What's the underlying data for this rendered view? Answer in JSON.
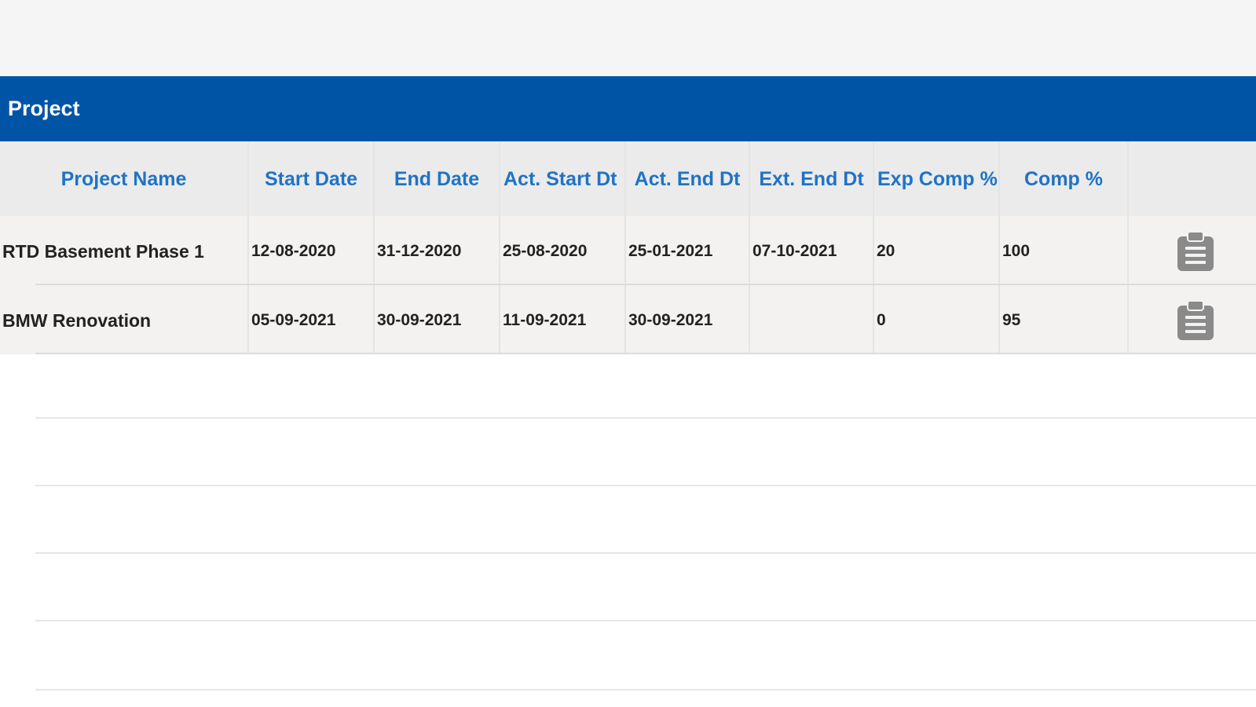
{
  "section": {
    "title": "Project"
  },
  "table": {
    "headers": [
      "Project Name",
      "Start Date",
      "End Date",
      "Act. Start Dt",
      "Act. End Dt",
      "Ext. End Dt",
      "Exp Comp %",
      "Comp %",
      ""
    ],
    "rows": [
      {
        "project_name": "RTD Basement Phase 1",
        "start_date": "12-08-2020",
        "end_date": "31-12-2020",
        "act_start_dt": "25-08-2020",
        "act_end_dt": "25-01-2021",
        "ext_end_dt": "07-10-2021",
        "exp_comp_pct": "20",
        "comp_pct": "100",
        "action_icon": "clipboard-icon"
      },
      {
        "project_name": "BMW Renovation",
        "start_date": "05-09-2021",
        "end_date": "30-09-2021",
        "act_start_dt": "11-09-2021",
        "act_end_dt": "30-09-2021",
        "ext_end_dt": "",
        "exp_comp_pct": "0",
        "comp_pct": "95",
        "action_icon": "clipboard-icon"
      }
    ]
  },
  "colors": {
    "header_bar": "#0054a6",
    "column_header_text": "#1f73c6",
    "row_background": "#f3f2f0",
    "icon": "#8a8a8a"
  }
}
